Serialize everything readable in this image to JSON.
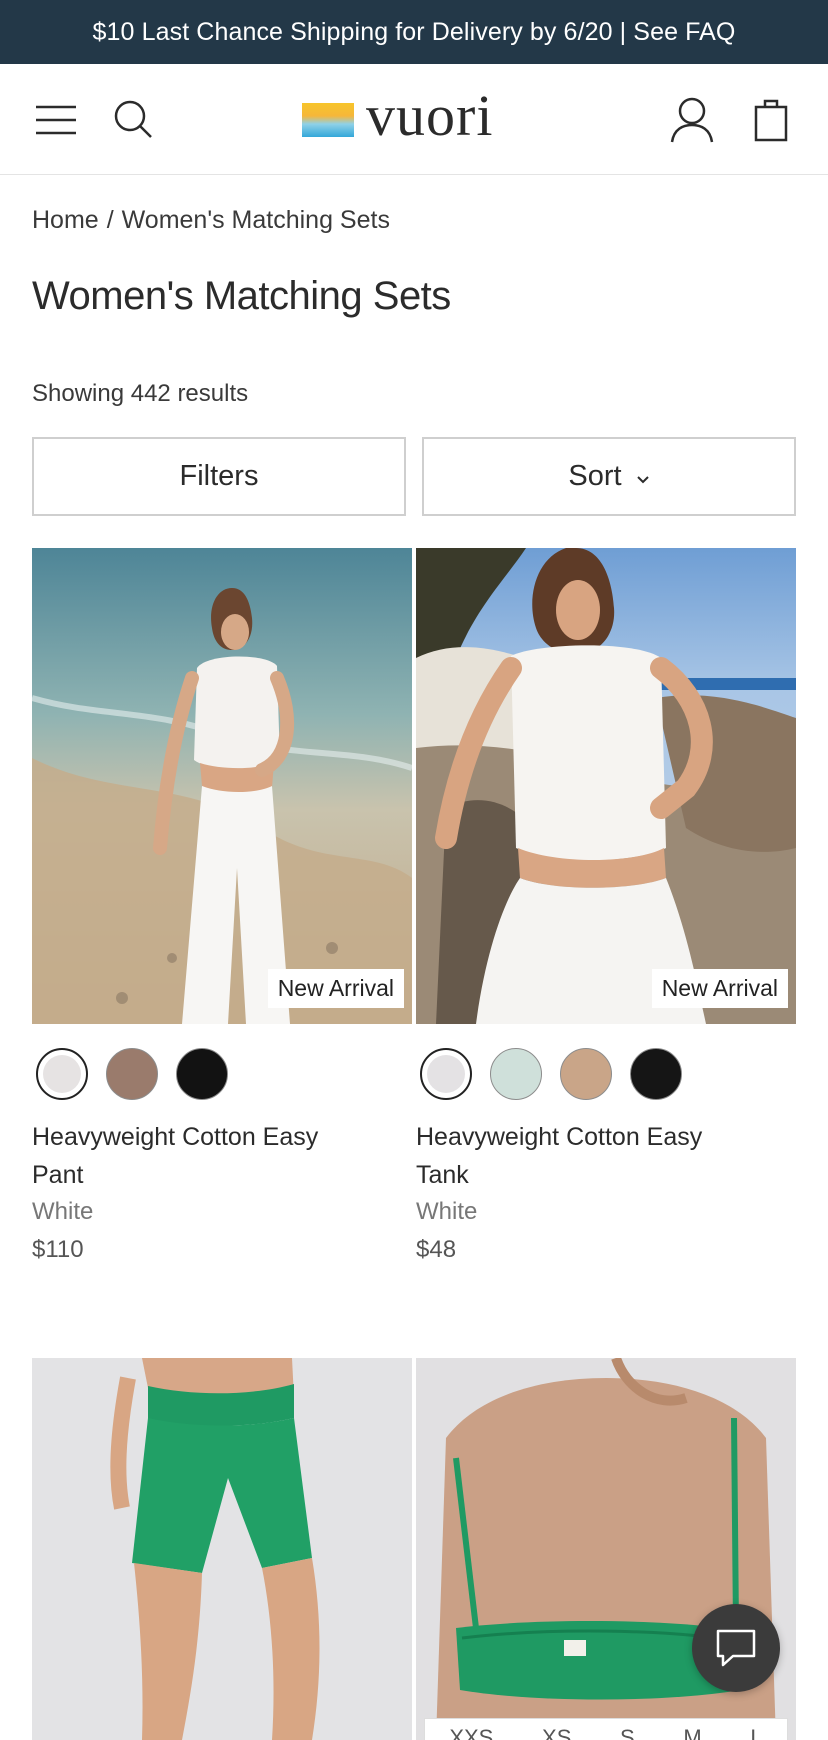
{
  "promo": {
    "text": "$10 Last Chance Shipping for Delivery by 6/20 | See FAQ"
  },
  "header": {
    "brand": "vuori",
    "icons": [
      "menu-icon",
      "search-icon",
      "account-icon",
      "bag-icon"
    ]
  },
  "breadcrumb": {
    "home": "Home",
    "separator": "/",
    "current": "Women's Matching Sets"
  },
  "page": {
    "title": "Women's Matching Sets",
    "results": "Showing 442 results"
  },
  "controls": {
    "filters": "Filters",
    "sort": "Sort"
  },
  "products": [
    {
      "name": "Heavyweight Cotton Easy Pant",
      "color": "White",
      "price": "$110",
      "badge": "New Arrival",
      "swatches": [
        "#e6e3e3",
        "#9a7b6c",
        "#121212"
      ]
    },
    {
      "name": "Heavyweight Cotton Easy Tank",
      "color": "White",
      "price": "$48",
      "badge": "New Arrival",
      "swatches": [
        "#e4e2e4",
        "#cfe0da",
        "#c9a588",
        "#151515"
      ]
    }
  ],
  "size_strip": [
    "XXS",
    "XS",
    "S",
    "M",
    "L"
  ],
  "colors": {
    "promo_bg": "#233848",
    "accent_green": "#1f9a63"
  }
}
